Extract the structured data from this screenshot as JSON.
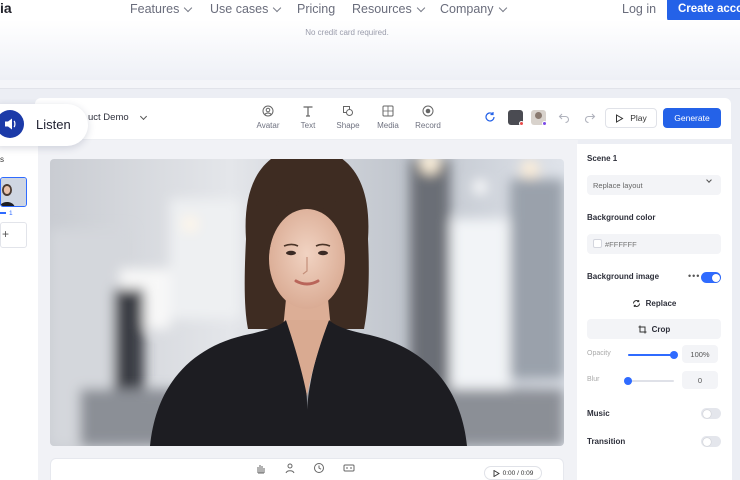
{
  "nav": {
    "logo": "ia",
    "items": [
      {
        "label": "Features",
        "dropdown": true
      },
      {
        "label": "Use cases",
        "dropdown": true
      },
      {
        "label": "Pricing",
        "dropdown": false
      },
      {
        "label": "Resources",
        "dropdown": true
      },
      {
        "label": "Company",
        "dropdown": true
      }
    ],
    "login": "Log in",
    "cta": "Create account"
  },
  "hero": {
    "no_card": "No credit card required."
  },
  "listen": {
    "label": "Listen"
  },
  "project": {
    "title": "uct Demo"
  },
  "tools": [
    {
      "label": "Avatar",
      "icon": "avatar-icon"
    },
    {
      "label": "Text",
      "icon": "text-icon"
    },
    {
      "label": "Shape",
      "icon": "shape-icon"
    },
    {
      "label": "Media",
      "icon": "media-icon"
    },
    {
      "label": "Record",
      "icon": "record-icon"
    }
  ],
  "toolbar": {
    "play": "Play",
    "generate": "Generate"
  },
  "scenes": {
    "label": "s",
    "thumb_number": "1",
    "add": "+"
  },
  "timeline": {
    "time": "0:00 / 0:09"
  },
  "panel": {
    "scene_title": "Scene 1",
    "layout": "Replace layout",
    "bg_color_label": "Background color",
    "bg_color_value": "#FFFFFF",
    "bg_image_label": "Background image",
    "bg_image_on": true,
    "replace": "Replace",
    "crop": "Crop",
    "opacity_label": "Opacity",
    "opacity_value": "100%",
    "opacity_level": 1.0,
    "blur_label": "Blur",
    "blur_value": "0",
    "blur_level": 0,
    "music_label": "Music",
    "music_on": false,
    "transition_label": "Transition",
    "transition_on": false
  },
  "colors": {
    "accent": "#2462e8",
    "listen": "#1b3aa8"
  }
}
